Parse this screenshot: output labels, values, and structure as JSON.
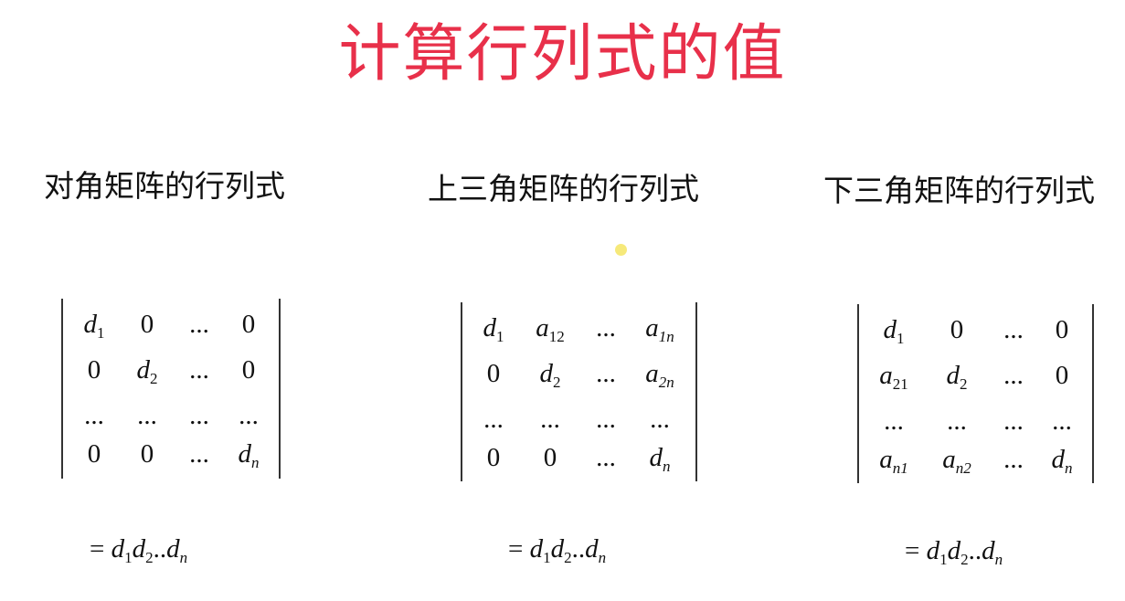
{
  "title": "计算行列式的值",
  "sections": [
    {
      "heading": "对角矩阵的行列式",
      "rows": [
        [
          [
            "d",
            "1"
          ],
          [
            "0",
            ""
          ],
          [
            "...",
            ""
          ],
          [
            "0",
            ""
          ]
        ],
        [
          [
            "0",
            ""
          ],
          [
            "d",
            "2"
          ],
          [
            "...",
            ""
          ],
          [
            "0",
            ""
          ]
        ],
        [
          [
            "...",
            ""
          ],
          [
            "...",
            ""
          ],
          [
            "...",
            ""
          ],
          [
            "...",
            ""
          ]
        ],
        [
          [
            "0",
            ""
          ],
          [
            "0",
            ""
          ],
          [
            "...",
            ""
          ],
          [
            "d",
            "n"
          ]
        ]
      ],
      "result": {
        "equals": "=",
        "d1": "d",
        "s1": "1",
        "d2": "d",
        "s2": "2",
        "dots": "..",
        "dn": "d",
        "sn": "n"
      }
    },
    {
      "heading": "上三角矩阵的行列式",
      "rows": [
        [
          [
            "d",
            "1"
          ],
          [
            "a",
            "12"
          ],
          [
            "...",
            ""
          ],
          [
            "a",
            "1n"
          ]
        ],
        [
          [
            "0",
            ""
          ],
          [
            "d",
            "2"
          ],
          [
            "...",
            ""
          ],
          [
            "a",
            "2n"
          ]
        ],
        [
          [
            "...",
            ""
          ],
          [
            "...",
            ""
          ],
          [
            "...",
            ""
          ],
          [
            "...",
            ""
          ]
        ],
        [
          [
            "0",
            ""
          ],
          [
            "0",
            ""
          ],
          [
            "...",
            ""
          ],
          [
            "d",
            "n"
          ]
        ]
      ],
      "result": {
        "equals": "=",
        "d1": "d",
        "s1": "1",
        "d2": "d",
        "s2": "2",
        "dots": "..",
        "dn": "d",
        "sn": "n"
      }
    },
    {
      "heading": "下三角矩阵的行列式",
      "rows": [
        [
          [
            "d",
            "1"
          ],
          [
            "0",
            ""
          ],
          [
            "...",
            ""
          ],
          [
            "0",
            ""
          ]
        ],
        [
          [
            "a",
            "21"
          ],
          [
            "d",
            "2"
          ],
          [
            "...",
            ""
          ],
          [
            "0",
            ""
          ]
        ],
        [
          [
            "...",
            ""
          ],
          [
            "...",
            ""
          ],
          [
            "...",
            ""
          ],
          [
            "...",
            ""
          ]
        ],
        [
          [
            "a",
            "n1"
          ],
          [
            "a",
            "n2"
          ],
          [
            "...",
            ""
          ],
          [
            "d",
            "n"
          ]
        ]
      ],
      "result": {
        "equals": "=",
        "d1": "d",
        "s1": "1",
        "d2": "d",
        "s2": "2",
        "dots": "..",
        "dn": "d",
        "sn": "n"
      }
    }
  ],
  "colors": {
    "title": "#e8304a",
    "text": "#111111",
    "pointer": "#f6e97a"
  }
}
